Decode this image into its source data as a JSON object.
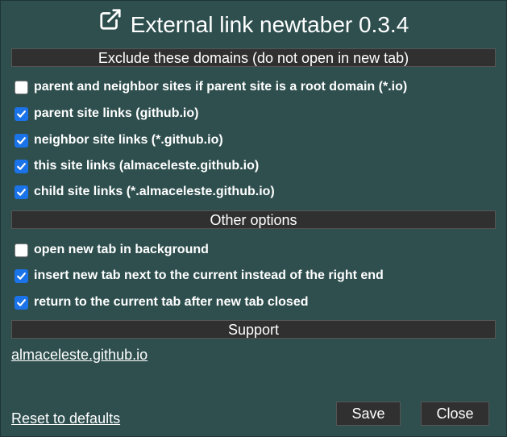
{
  "header": {
    "title": "External link newtaber 0.3.4",
    "icon": "external-link-icon"
  },
  "sections": {
    "exclude": "Exclude these domains (do not open in new tab)",
    "other": "Other options",
    "support": "Support"
  },
  "exclude_options": [
    {
      "label": "parent and neighbor sites if parent site is a root domain (*.io)",
      "checked": false
    },
    {
      "label": "parent site links (github.io)",
      "checked": true
    },
    {
      "label": "neighbor site links (*.github.io)",
      "checked": true
    },
    {
      "label": "this site links (almaceleste.github.io)",
      "checked": true
    },
    {
      "label": "child site links (*.almaceleste.github.io)",
      "checked": true
    }
  ],
  "other_options": [
    {
      "label": "open new tab in background",
      "checked": false
    },
    {
      "label": "insert new tab next to the current instead of the right end",
      "checked": true
    },
    {
      "label": "return to the current tab after new tab closed",
      "checked": true
    }
  ],
  "support_link": "almaceleste.github.io",
  "footer": {
    "reset_link": "Reset to defaults",
    "save_label": "Save",
    "close_label": "Close"
  },
  "colors": {
    "background": "#2f4f4f",
    "section_bar": "#303030",
    "checkbox_accent": "#1a73e8"
  }
}
